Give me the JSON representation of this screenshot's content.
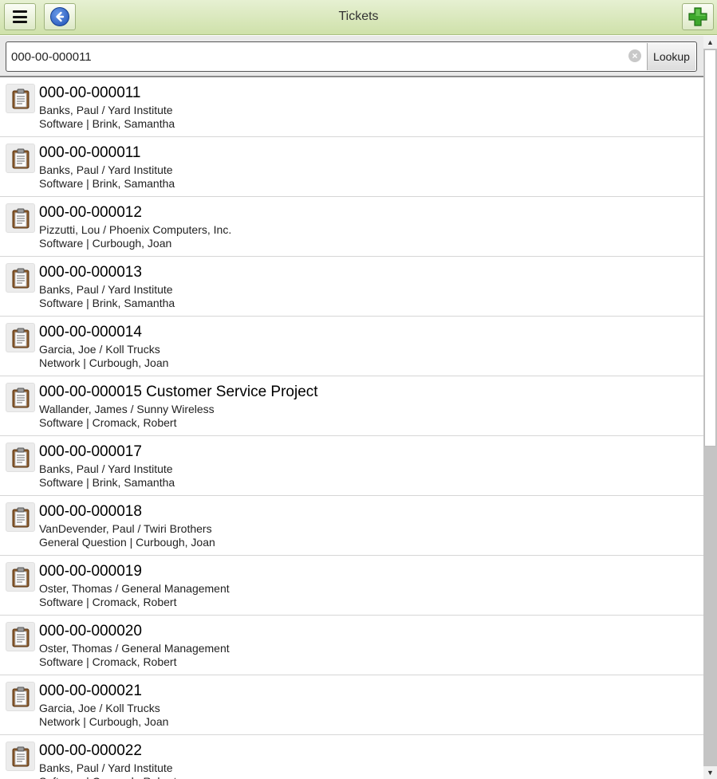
{
  "header": {
    "title": "Tickets",
    "menu_icon": "hamburger-menu-icon",
    "back_icon": "back-arrow-icon",
    "add_icon": "plus-icon"
  },
  "search": {
    "value": "000-00-000011",
    "lookup_label": "Lookup",
    "clear_icon": "clear-icon"
  },
  "tickets": [
    {
      "title": "000-00-000011",
      "contact": "Banks, Paul / Yard Institute",
      "meta": "Software | Brink, Samantha"
    },
    {
      "title": "000-00-000011",
      "contact": "Banks, Paul / Yard Institute",
      "meta": "Software | Brink, Samantha"
    },
    {
      "title": "000-00-000012",
      "contact": "Pizzutti, Lou / Phoenix Computers, Inc.",
      "meta": "Software | Curbough, Joan"
    },
    {
      "title": "000-00-000013",
      "contact": "Banks, Paul / Yard Institute",
      "meta": "Software | Brink, Samantha"
    },
    {
      "title": "000-00-000014",
      "contact": "Garcia, Joe / Koll Trucks",
      "meta": "Network | Curbough, Joan"
    },
    {
      "title": "000-00-000015 Customer Service Project",
      "contact": "Wallander, James / Sunny Wireless",
      "meta": "Software | Cromack, Robert"
    },
    {
      "title": "000-00-000017",
      "contact": "Banks, Paul / Yard Institute",
      "meta": "Software | Brink, Samantha"
    },
    {
      "title": "000-00-000018",
      "contact": "VanDevender, Paul / Twiri Brothers",
      "meta": "General Question | Curbough, Joan"
    },
    {
      "title": "000-00-000019",
      "contact": "Oster, Thomas / General Management",
      "meta": "Software | Cromack, Robert"
    },
    {
      "title": "000-00-000020",
      "contact": "Oster, Thomas / General Management",
      "meta": "Software | Cromack, Robert"
    },
    {
      "title": "000-00-000021",
      "contact": "Garcia, Joe / Koll Trucks",
      "meta": "Network | Curbough, Joan"
    },
    {
      "title": "000-00-000022",
      "contact": "Banks, Paul / Yard Institute",
      "meta": "Software | Cromack, Robert"
    }
  ]
}
